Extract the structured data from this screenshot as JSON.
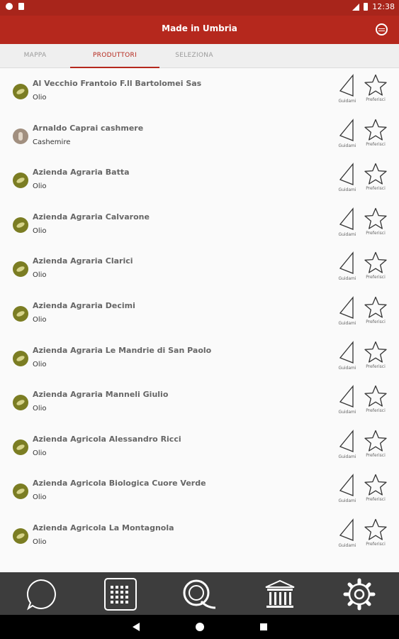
{
  "status_bar": {
    "time": "12:38"
  },
  "app_bar": {
    "title": "Made in Umbria"
  },
  "tabs": [
    {
      "label": "MAPPA"
    },
    {
      "label": "PRODUTTORI"
    },
    {
      "label": "SELEZIONA"
    }
  ],
  "actions": {
    "guide_label": "Guidami",
    "fav_label": "Preferisci"
  },
  "producers": [
    {
      "name": "Al Vecchio Frantoio F.ll Bartolomei Sas",
      "category": "Olio"
    },
    {
      "name": "Arnaldo Caprai cashmere",
      "category": "Cashemire"
    },
    {
      "name": "Azienda Agraria Batta",
      "category": "Olio"
    },
    {
      "name": "Azienda Agraria Calvarone",
      "category": "Olio"
    },
    {
      "name": "Azienda Agraria Clarici",
      "category": "Olio"
    },
    {
      "name": "Azienda Agraria Decimi",
      "category": "Olio"
    },
    {
      "name": "Azienda Agraria Le Mandrie di San Paolo",
      "category": "Olio"
    },
    {
      "name": "Azienda Agraria Manneli Giulio",
      "category": "Olio"
    },
    {
      "name": "Azienda Agricola Alessandro Ricci",
      "category": "Olio"
    },
    {
      "name": "Azienda Agricola Biologica Cuore Verde",
      "category": "Olio"
    },
    {
      "name": "Azienda Agricola La Montagnola",
      "category": "Olio"
    }
  ],
  "bottom_nav": [
    {
      "icon": "chat-bubble-icon"
    },
    {
      "icon": "calendar-icon"
    },
    {
      "icon": "search-q-icon"
    },
    {
      "icon": "museum-icon"
    },
    {
      "icon": "gear-icon"
    }
  ],
  "colors": {
    "primary": "#b5281d",
    "status_bar": "#a8251b",
    "bottom_bar": "#3d3d3d",
    "olive": "#7b7d23"
  }
}
